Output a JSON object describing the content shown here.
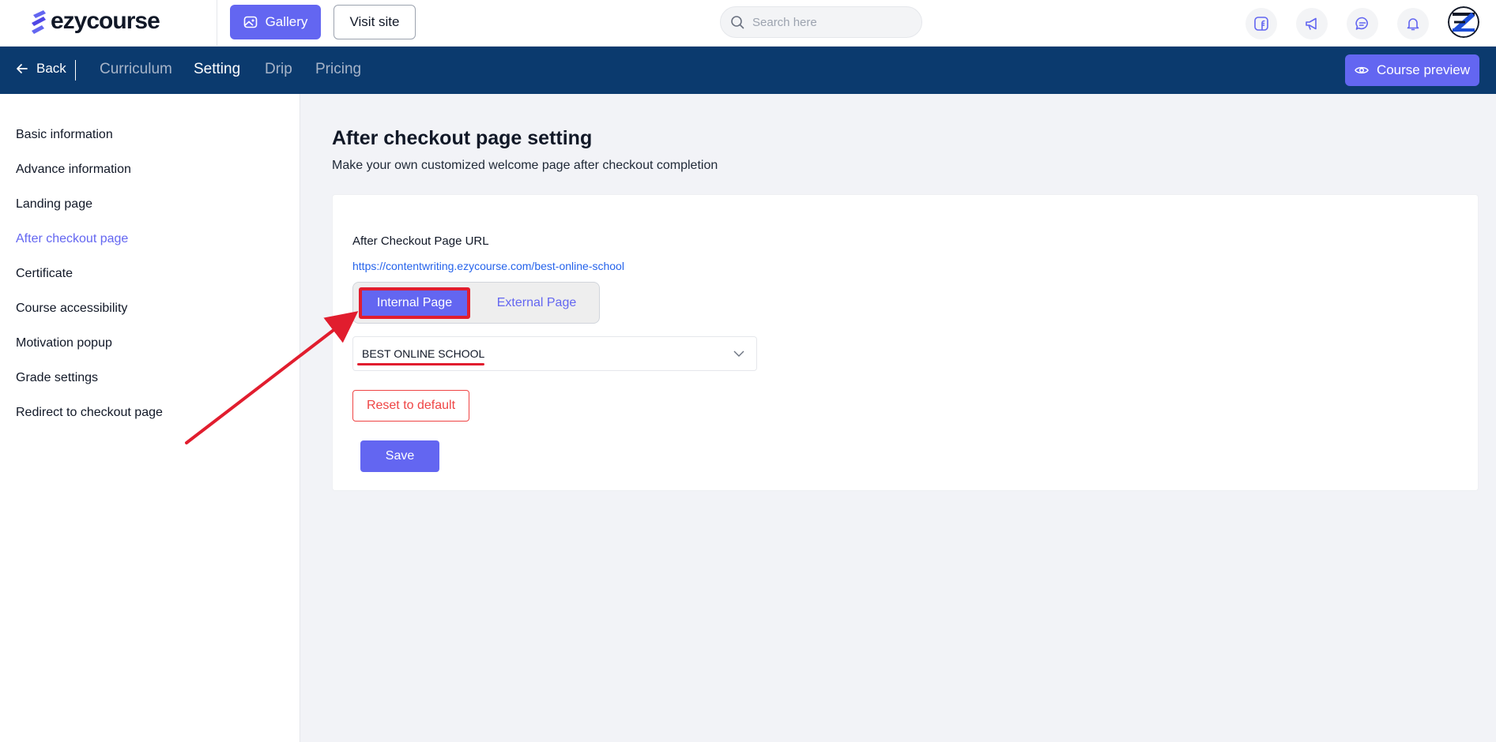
{
  "brand": {
    "name": "ezycourse",
    "accent": "#6366f1",
    "nav_bg": "#0b3a6e"
  },
  "header": {
    "gallery_label": "Gallery",
    "visit_label": "Visit site",
    "search_placeholder": "Search here",
    "icons": [
      "facebook-icon",
      "megaphone-icon",
      "chat-icon",
      "bell-icon"
    ]
  },
  "nav": {
    "back_label": "Back",
    "tabs": [
      {
        "label": "Curriculum",
        "active": false
      },
      {
        "label": "Setting",
        "active": true
      },
      {
        "label": "Drip",
        "active": false
      },
      {
        "label": "Pricing",
        "active": false
      }
    ],
    "preview_label": "Course preview"
  },
  "sidebar": {
    "items": [
      {
        "label": "Basic information",
        "active": false
      },
      {
        "label": "Advance information",
        "active": false
      },
      {
        "label": "Landing page",
        "active": false
      },
      {
        "label": "After checkout page",
        "active": true
      },
      {
        "label": "Certificate",
        "active": false
      },
      {
        "label": "Course accessibility",
        "active": false
      },
      {
        "label": "Motivation popup",
        "active": false
      },
      {
        "label": "Grade settings",
        "active": false
      },
      {
        "label": "Redirect to checkout page",
        "active": false
      }
    ]
  },
  "main": {
    "title": "After checkout page setting",
    "subtitle": "Make your own customized welcome page after checkout completion",
    "url_label": "After Checkout Page URL",
    "url": "https://contentwriting.ezycourse.com/best-online-school",
    "toggle": {
      "internal_label": "Internal Page",
      "external_label": "External Page",
      "selected": "Internal Page"
    },
    "select_value": "BEST ONLINE SCHOOL",
    "reset_label": "Reset to default",
    "save_label": "Save"
  },
  "annotation": {
    "color": "#e11d2e"
  }
}
